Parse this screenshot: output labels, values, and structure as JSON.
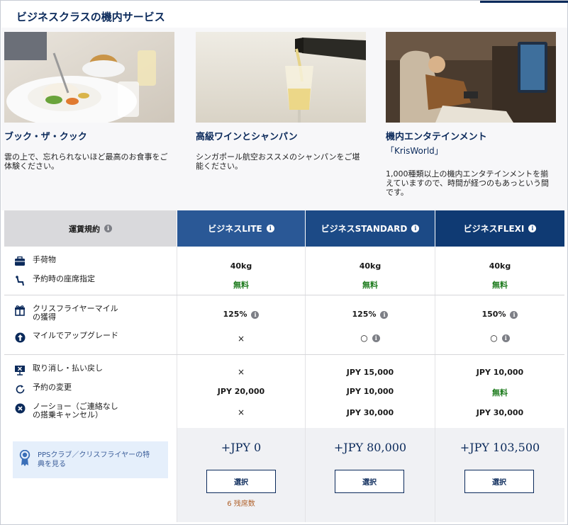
{
  "page": {
    "title": "ビジネスクラスの機内サービス"
  },
  "services": [
    {
      "title": "ブック・ザ・クック",
      "subtitle": "",
      "description": "雲の上で、忘れられないほど最高のお食事をご体験ください。"
    },
    {
      "title": "高級ワインとシャンパン",
      "subtitle": "",
      "description": "シンガポール航空おススメのシャンパンをご堪能ください。"
    },
    {
      "title": "機内エンタテインメント",
      "subtitle": "「KrisWorld」",
      "description": "1,000種類以上の機内エンタテインメントを揃えていますので、時間が経つのもあっという間です。"
    }
  ],
  "fare_table": {
    "header_label": "運賃規約",
    "columns": [
      {
        "name": "ビジネスLITE",
        "color": "#2a5896"
      },
      {
        "name": "ビジネスSTANDARD",
        "color": "#1c4a86"
      },
      {
        "name": "ビジネスFLEXI",
        "color": "#0f3a73"
      }
    ],
    "rows": {
      "baggage": {
        "label": "手荷物",
        "icon": "suitcase-icon",
        "values": [
          "40kg",
          "40kg",
          "40kg"
        ]
      },
      "seat": {
        "label": "予約時の座席指定",
        "icon": "seat-icon",
        "values": [
          "無料",
          "無料",
          "無料"
        ]
      },
      "miles": {
        "label_line1": "クリスフライヤーマイル",
        "label_line2": "の獲得",
        "icon": "gift-icon",
        "values": [
          "125%",
          "125%",
          "150%"
        ]
      },
      "upgrade": {
        "label": "マイルでアップグレード",
        "icon": "upgrade-arrow-icon",
        "values": [
          "×",
          "○",
          "○"
        ]
      },
      "cancel": {
        "label": "取り消し・払い戻し",
        "icon": "cancel-screen-icon",
        "values": [
          "×",
          "JPY 15,000",
          "JPY 10,000"
        ]
      },
      "change": {
        "label": "予約の変更",
        "icon": "change-refresh-icon",
        "values": [
          "JPY 20,000",
          "JPY 10,000",
          "無料"
        ]
      },
      "noshow": {
        "label_line1": "ノーショー（ご連絡なし",
        "label_line2": "の搭乗キャンセル）",
        "icon": "noshow-x-icon",
        "values": [
          "×",
          "JPY 30,000",
          "JPY 30,000"
        ]
      }
    },
    "prices": [
      "+JPY 0",
      "+JPY 80,000",
      "+JPY 103,500"
    ],
    "select_label": "選択",
    "seats_left": "6 残席数",
    "pps_text_line1": "PPSクラブ／クリスフライヤーの特",
    "pps_text_line2": "典を見る",
    "info_glyph": "i"
  }
}
